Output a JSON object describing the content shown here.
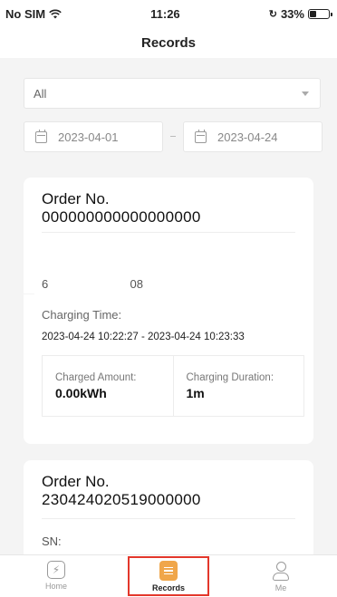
{
  "status_bar": {
    "carrier": "No SIM",
    "time": "11:26",
    "battery": "33%",
    "battery_level": 0.33
  },
  "header": {
    "title": "Records"
  },
  "filter": {
    "selected": "All"
  },
  "date_range": {
    "start": "2023-04-01",
    "end": "2023-04-24"
  },
  "records": [
    {
      "order_label": "Order No.",
      "order_no": "000000000000000000",
      "sn_fragment": "6                         08",
      "charging_time_label": "Charging Time:",
      "charging_time": "2023-04-24 10:22:27 - 2023-04-24 10:23:33",
      "charged_amount_label": "Charged Amount:",
      "charged_amount": "0.00kWh",
      "charging_duration_label": "Charging Duration:",
      "charging_duration": "1m"
    },
    {
      "order_label": "Order No.",
      "order_no": "230424020519000000",
      "sn_label": "SN:"
    }
  ],
  "tabs": [
    {
      "label": "Home",
      "icon": "lightning-icon"
    },
    {
      "label": "Records",
      "icon": "document-icon",
      "active": true
    },
    {
      "label": "Me",
      "icon": "user-icon"
    }
  ],
  "colors": {
    "accent": "#f0a64a",
    "highlight": "#e3372b"
  }
}
